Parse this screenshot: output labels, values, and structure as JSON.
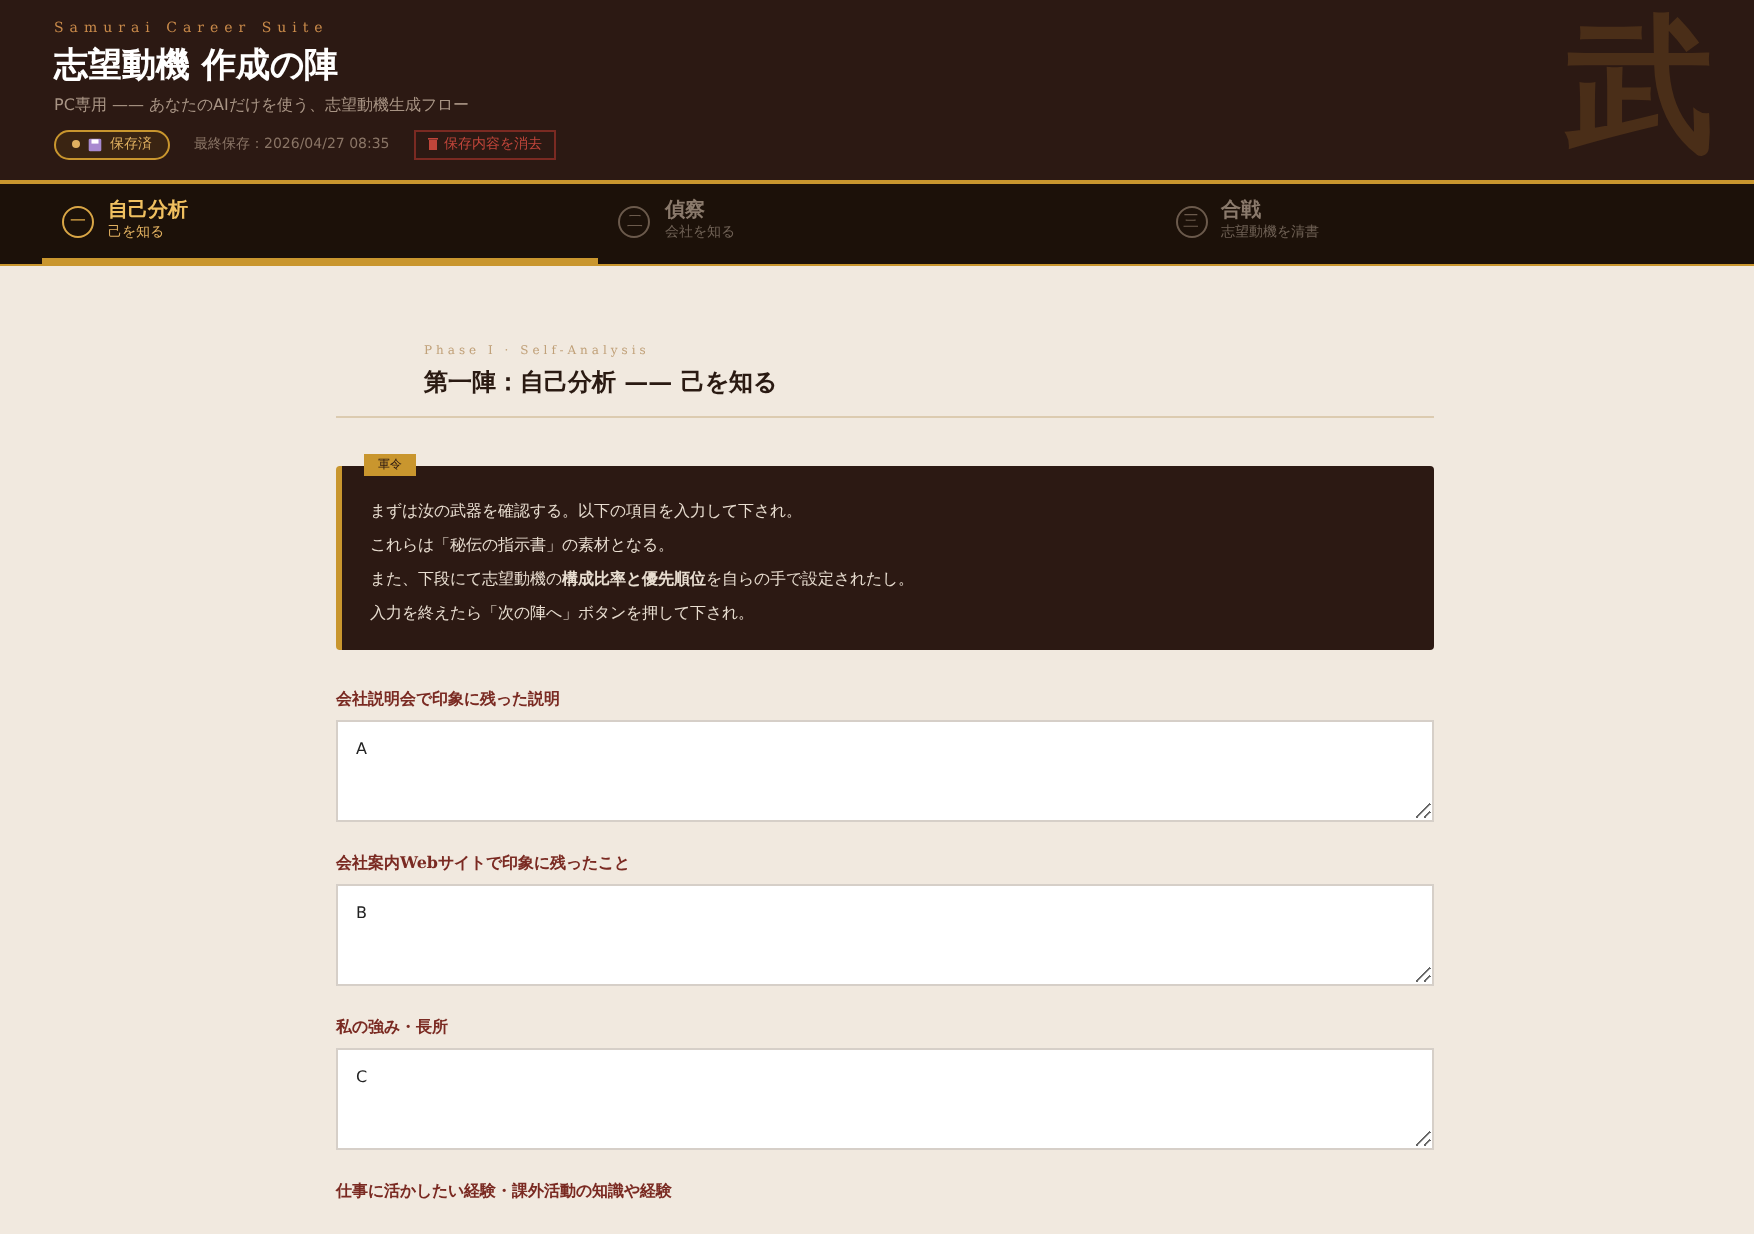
{
  "header": {
    "brand": "Samurai Career Suite",
    "title": "志望動機 作成の陣",
    "subtitle": "PC専用 —— あなたのAIだけを使う、志望動機生成フロー",
    "save_status": {
      "label": "保存済",
      "saved": true
    },
    "last_saved": "最終保存：2026/04/27 08:35",
    "clear_button": "保存内容を消去",
    "emblem": "武"
  },
  "steps": [
    {
      "number": "一",
      "title": "自己分析",
      "subtitle": "己を知る",
      "selected": true
    },
    {
      "number": "二",
      "title": "偵察",
      "subtitle": "会社を知る",
      "selected": false
    },
    {
      "number": "三",
      "title": "合戦",
      "subtitle": "志望動機を清書",
      "selected": false
    }
  ],
  "section": {
    "eyebrow": "Phase I · Self-Analysis",
    "title": "第一陣：自己分析 —— 己を知る"
  },
  "notice": {
    "badge": "軍令",
    "lines": [
      "まずは汝の武器を確認する。以下の項目を入力して下され。",
      "これらは「秘伝の指示書」の素材となる。",
      "また、下段にて志望動機の**構成比率と優先順位**を自らの手で設定されたし。",
      "入力を終えたら「次の陣へ」ボタンを押して下され。"
    ]
  },
  "fields": [
    {
      "label": "会社説明会で印象に残った説明",
      "value": "A"
    },
    {
      "label": "会社案内Webサイトで印象に残ったこと",
      "value": "B"
    },
    {
      "label": "私の強み・長所",
      "value": "C"
    },
    {
      "label": "仕事に活かしたい経験・課外活動の知識や経験"
    }
  ]
}
